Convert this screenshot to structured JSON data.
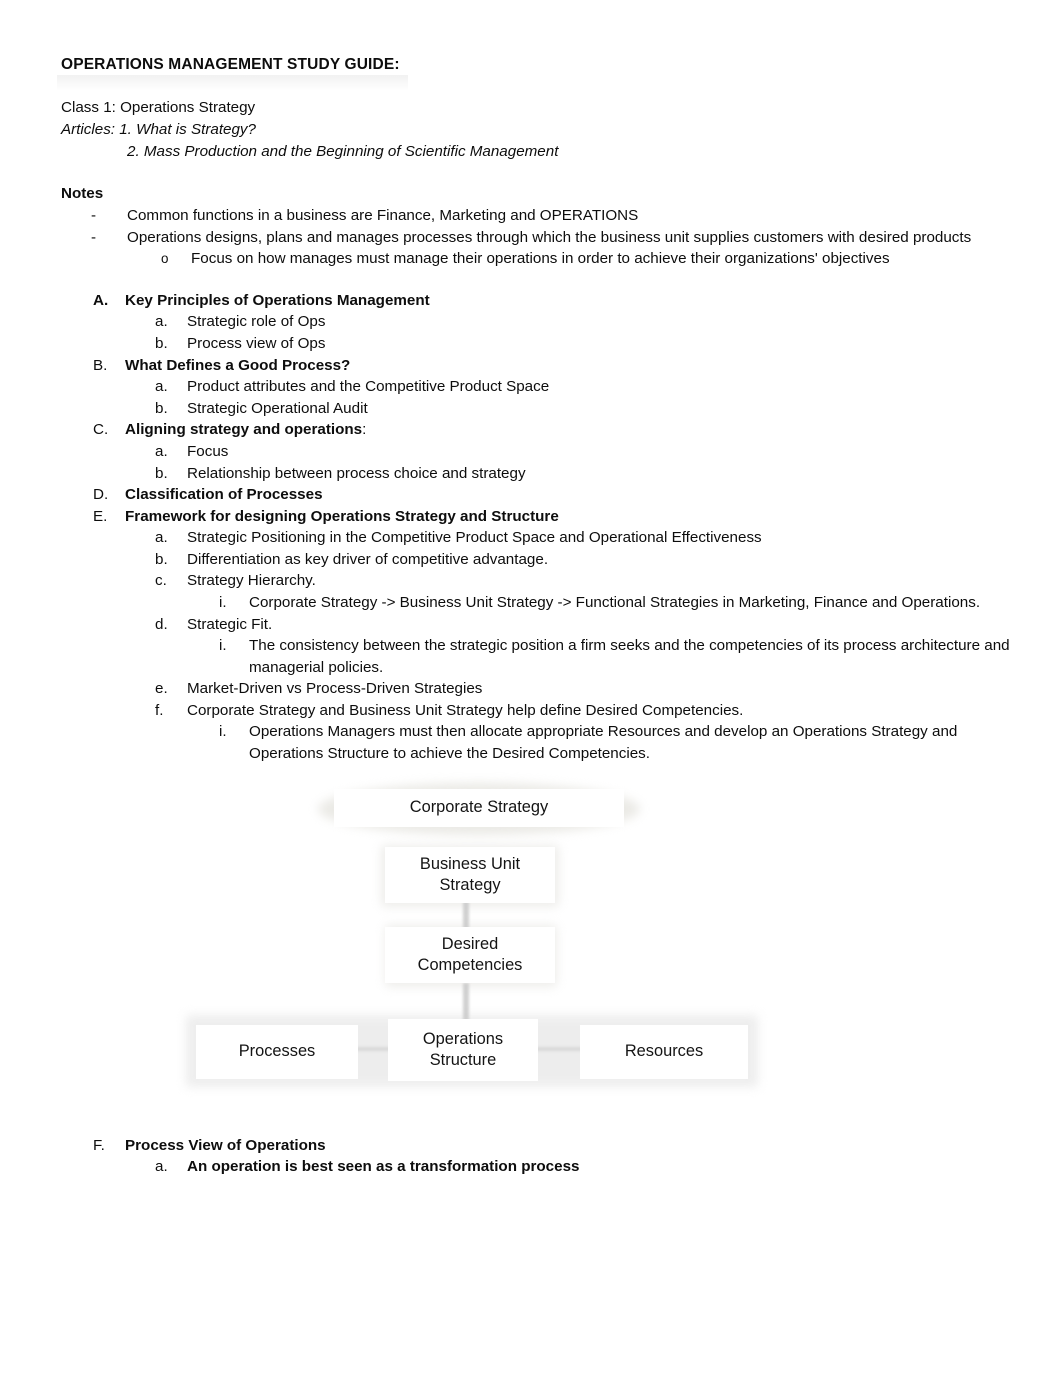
{
  "document": {
    "title": "OPERATIONS MANAGEMENT STUDY GUIDE:",
    "class_line": "Class 1: Operations Strategy",
    "articles_label": "Articles: 1. What is Strategy?",
    "articles_second": "2. Mass Production and the Beginning of Scientific Management",
    "notes_heading": "Notes"
  },
  "notes": {
    "bullets": [
      {
        "marker": "-",
        "text": "Common functions in a business are Finance, Marketing and OPERATIONS"
      },
      {
        "marker": "-",
        "text": "Operations designs, plans and manages processes through which the business unit supplies customers with desired products"
      }
    ],
    "sub_bullet": {
      "marker": "o",
      "text": "Focus on how manages must manage their operations in order to achieve their organizations' objectives"
    }
  },
  "outline": [
    {
      "marker": "A.",
      "title": "Key Principles of Operations Management",
      "marker_bold": true,
      "children": [
        {
          "marker": "a.",
          "text": "Strategic role of Ops"
        },
        {
          "marker": "b.",
          "text": "Process view of Ops"
        }
      ]
    },
    {
      "marker": "B.",
      "title": "What Defines a Good Process?",
      "marker_bold": false,
      "children": [
        {
          "marker": "a.",
          "text": "Product attributes and the Competitive Product Space"
        },
        {
          "marker": "b.",
          "text": "Strategic Operational Audit"
        }
      ]
    },
    {
      "marker": "C.",
      "title": "Aligning strategy and operations",
      "title_suffix": ":",
      "marker_bold": false,
      "children": [
        {
          "marker": "a.",
          "text": "Focus"
        },
        {
          "marker": "b.",
          "text": "Relationship between process choice and strategy"
        }
      ]
    },
    {
      "marker": "D.",
      "title": "Classification of Processes",
      "marker_bold": false,
      "children": []
    },
    {
      "marker": "E.",
      "title": "Framework for designing Operations Strategy and Structure",
      "marker_bold": false,
      "children": [
        {
          "marker": "a.",
          "text": "Strategic Positioning in the Competitive Product Space and Operational Effectiveness"
        },
        {
          "marker": "b.",
          "text": "Differentiation as key driver of competitive advantage."
        },
        {
          "marker": "c.",
          "text": "Strategy Hierarchy.",
          "sub": [
            {
              "marker": "i.",
              "text": "Corporate Strategy -> Business Unit Strategy -> Functional Strategies in Marketing, Finance and Operations."
            }
          ]
        },
        {
          "marker": "d.",
          "text": "Strategic Fit.",
          "sub": [
            {
              "marker": "i.",
              "text": "The consistency between the strategic position a firm seeks and the competencies of its process architecture and managerial policies."
            }
          ]
        },
        {
          "marker": "e.",
          "text": "Market-Driven vs Process-Driven Strategies"
        },
        {
          "marker": "f.",
          "text": "Corporate Strategy and Business Unit Strategy help define Desired Competencies.",
          "sub": [
            {
              "marker": "i.",
              "text": "Operations Managers must then allocate appropriate Resources and develop an Operations Strategy and Operations Structure to achieve the Desired Competencies."
            }
          ]
        }
      ]
    }
  ],
  "diagram": {
    "nodes": {
      "corporate_strategy": "Corporate Strategy",
      "business_unit_strategy": "Business Unit\nStrategy",
      "desired_competencies": "Desired\nCompetencies",
      "processes": "Processes",
      "operations_structure": "Operations\nStructure",
      "resources": "Resources"
    },
    "node_fill": "#ffffff",
    "shadow_color": "#dedede"
  },
  "tail": {
    "marker": "F.",
    "title": "Process View of Operations",
    "child_marker": "a.",
    "child_text": "An operation is best seen as a transformation process"
  }
}
